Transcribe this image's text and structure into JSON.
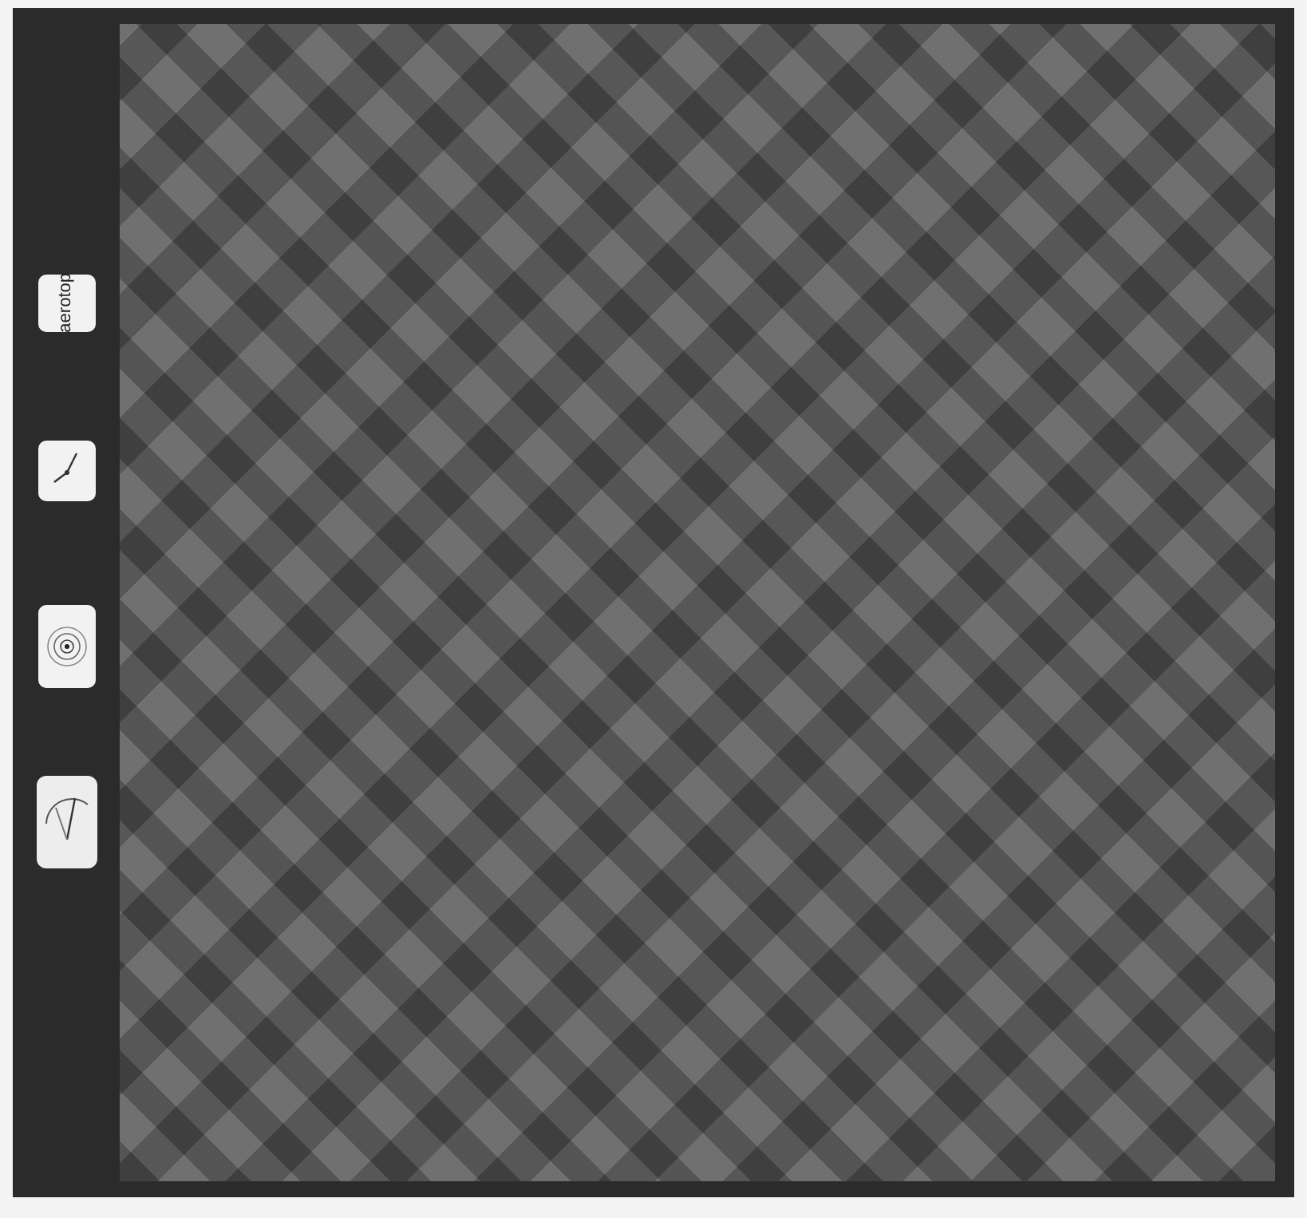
{
  "data_strip": [
    {
      "kind": "label",
      "text": "aerotop"
    },
    {
      "kind": "clock"
    },
    {
      "kind": "level"
    },
    {
      "kind": "altimeter"
    }
  ]
}
